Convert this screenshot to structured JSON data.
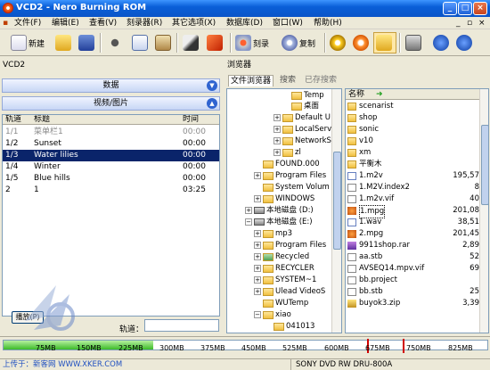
{
  "window": {
    "title": "VCD2 - Nero Burning ROM"
  },
  "menu": [
    "文件(F)",
    "编辑(E)",
    "查看(V)",
    "刻录器(R)",
    "其它选项(X)",
    "数据库(D)",
    "窗口(W)",
    "帮助(H)"
  ],
  "toolbar": {
    "new_label": "新建",
    "burn_label": "刻录",
    "copy_label": "复制"
  },
  "left_panel": {
    "title": "VCD2",
    "section_data": "数据",
    "section_video": "视频/图片",
    "columns": {
      "track": "轨道",
      "title": "标题",
      "time": "时间"
    },
    "tracks": [
      {
        "track": "1/1",
        "title": "菜单栏1",
        "time": "00:00"
      },
      {
        "track": "1/2",
        "title": "Sunset",
        "time": "00:00"
      },
      {
        "track": "1/3",
        "title": "Water lilies",
        "time": "00:00"
      },
      {
        "track": "1/4",
        "title": "Winter",
        "time": "00:00"
      },
      {
        "track": "1/5",
        "title": "Blue hills",
        "time": "00:00"
      },
      {
        "track": "2",
        "title": "1",
        "time": "03:25"
      }
    ],
    "play_button": "播放(P)",
    "track_label": "轨道："
  },
  "browser": {
    "title": "浏览器",
    "tabs": [
      "文件浏览器",
      "搜索",
      "已存搜索"
    ],
    "tree": [
      "Temp",
      "桌面",
      "Default U",
      "LocalServ",
      "NetworkS",
      "zl",
      "FOUND.000",
      "Program Files",
      "System Volum",
      "WINDOWS",
      "本地磁盘 (D:)",
      "本地磁盘 (E:)",
      "mp3",
      "Program Files",
      "Recycled",
      "RECYCLER",
      "SYSTEM~1",
      "Ulead VideoS",
      "WUTemp",
      "xiao",
      "041013"
    ],
    "file_header": "名称",
    "files": [
      {
        "name": "scenarist",
        "size": ""
      },
      {
        "name": "shop",
        "size": ""
      },
      {
        "name": "sonic",
        "size": ""
      },
      {
        "name": "v10",
        "size": ""
      },
      {
        "name": "xm",
        "size": ""
      },
      {
        "name": "平衡木",
        "size": ""
      },
      {
        "name": "1.m2v",
        "size": "195,57"
      },
      {
        "name": "1.M2V.index2",
        "size": "8"
      },
      {
        "name": "1.m2v.vif",
        "size": "40"
      },
      {
        "name": "1.mpg",
        "size": "201,08"
      },
      {
        "name": "1.wav",
        "size": "38,51"
      },
      {
        "name": "2.mpg",
        "size": "201,45"
      },
      {
        "name": "9911shop.rar",
        "size": "2,89"
      },
      {
        "name": "aa.stb",
        "size": "52"
      },
      {
        "name": "AVSEQ14.mpv.vif",
        "size": "69"
      },
      {
        "name": "bb.project",
        "size": ""
      },
      {
        "name": "bb.stb",
        "size": "25"
      },
      {
        "name": "buyok3.zip",
        "size": "3,39"
      }
    ]
  },
  "capacity": {
    "fill_fraction": 0.31,
    "ticks": [
      "75MB",
      "150MB",
      "225MB",
      "300MB",
      "375MB",
      "450MB",
      "525MB",
      "600MB",
      "675MB",
      "750MB",
      "825MB"
    ]
  },
  "status": {
    "watermark": "上传于：新客网 WWW.XKER.COM",
    "drive": "SONY    DVD RW DRU-800A"
  },
  "colors": {
    "accent": "#0a246a",
    "titlebar": "#0a5fd8"
  }
}
